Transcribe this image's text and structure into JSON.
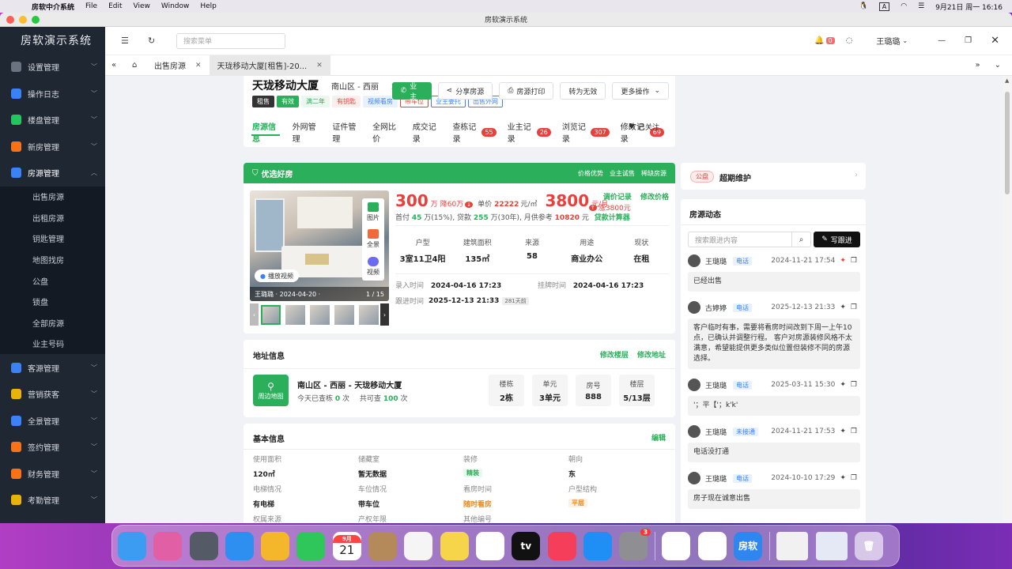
{
  "menubar": {
    "app_name": "房软中介系统",
    "menus": [
      "File",
      "Edit",
      "View",
      "Window",
      "Help"
    ],
    "datetime": "9月21日 周一  16:16",
    "input_indicator": "A"
  },
  "window": {
    "title": "房软演示系统"
  },
  "sidebar": {
    "brand": "房软演示系统",
    "items_top": [
      {
        "label": "设置管理",
        "color": "#6b7280",
        "icon": "gear-icon"
      },
      {
        "label": "操作日志",
        "color": "#3b82f6",
        "icon": "clock-icon"
      },
      {
        "label": "楼盘管理",
        "color": "#22c55e",
        "icon": "chart-icon"
      },
      {
        "label": "新房管理",
        "color": "#f97316",
        "icon": "building-icon"
      },
      {
        "label": "房源管理",
        "color": "#3b82f6",
        "icon": "home-icon"
      }
    ],
    "sub_items": [
      "出售房源",
      "出租房源",
      "钥匙管理",
      "地图找房",
      "公盘",
      "锁盘",
      "全部房源",
      "业主号码"
    ],
    "items_bottom": [
      {
        "label": "客源管理",
        "color": "#3b82f6",
        "icon": "user-icon"
      },
      {
        "label": "营销获客",
        "color": "#eab308",
        "icon": "megaphone-icon"
      },
      {
        "label": "全景管理",
        "color": "#3b82f6",
        "icon": "panorama-icon"
      },
      {
        "label": "签约管理",
        "color": "#f97316",
        "icon": "stamp-icon"
      },
      {
        "label": "财务管理",
        "color": "#f97316",
        "icon": "money-icon"
      },
      {
        "label": "考勤管理",
        "color": "#eab308",
        "icon": "calendar-icon"
      }
    ]
  },
  "topbar": {
    "search_placeholder": "搜索菜单",
    "notify_count": "0",
    "user": "王璐璐"
  },
  "tabs": [
    {
      "label": "出售房源"
    },
    {
      "label": "天珑移动大厦[租售]-20..."
    }
  ],
  "house": {
    "name": "天珑移动大厦",
    "district": "南山区 - 西丽",
    "code": "20786",
    "tags": [
      {
        "text": "租售",
        "bg": "#333333",
        "fg": "#ffffff",
        "bd": "#333333"
      },
      {
        "text": "有效",
        "bg": "#2baf5a",
        "fg": "#ffffff",
        "bd": "#2baf5a"
      },
      {
        "text": "满二年",
        "bg": "#eaf8ef",
        "fg": "#2baf5a",
        "bd": "#eaf8ef"
      },
      {
        "text": "有钥匙",
        "bg": "#fdeeee",
        "fg": "#e8413c",
        "bd": "#fdeeee"
      },
      {
        "text": "视频看房",
        "bg": "#e8f1ff",
        "fg": "#3b82f6",
        "bd": "#e8f1ff"
      },
      {
        "text": "带车位",
        "bg": "#ffffff",
        "fg": "#e8413c",
        "bd": "#e8413c"
      },
      {
        "text": "业主委托",
        "bg": "#ffffff",
        "fg": "#3b82f6",
        "bd": "#3b82f6"
      },
      {
        "text": "出售外网",
        "bg": "#ffffff",
        "fg": "#3b82f6",
        "bd": "#3b82f6"
      }
    ],
    "buttons": {
      "owner": "业主",
      "share": "分享房源",
      "print": "房源打印",
      "invalid": "转为无效",
      "more": "更多操作"
    },
    "subtabs": [
      {
        "label": "房源信息",
        "count": ""
      },
      {
        "label": "外网管理",
        "count": ""
      },
      {
        "label": "证件管理",
        "count": ""
      },
      {
        "label": "全网比价",
        "count": ""
      },
      {
        "label": "成交记录",
        "count": ""
      },
      {
        "label": "查栋记录",
        "count": "55"
      },
      {
        "label": "业主记录",
        "count": "26"
      },
      {
        "label": "浏览记录",
        "count": "307"
      },
      {
        "label": "修改记录",
        "count": "69"
      }
    ],
    "followed": "已关注"
  },
  "premium": {
    "title": "优选好房",
    "links": [
      "价格优势",
      "业主诚售",
      "稀缺房源"
    ]
  },
  "gallery": {
    "side_buttons": [
      "图片",
      "全景",
      "视频"
    ],
    "play_label": "播放视频",
    "caption": "王璐璐 · 2024-04-20 ·",
    "counter": "1 / 15",
    "thumb_count": 5
  },
  "price": {
    "sale": "300",
    "sale_unit": "万",
    "sale_drop": "降60万",
    "unit_price_label": "单价",
    "unit_price": "22222",
    "unit_price_unit": "元/㎡",
    "rent": "3800",
    "rent_unit": "元/月",
    "rent_rise": "涨3800元",
    "links": {
      "adjust": "调价记录",
      "modify": "修改价格"
    },
    "mortgage": {
      "prefix": "首付",
      "down": "45",
      "mid": "万(15%), 贷款",
      "loan": "255",
      "years": "万(30年), 月供参考",
      "monthly": "10820",
      "unit": "元",
      "calc": "贷款计算器"
    }
  },
  "specs": [
    {
      "label": "户型",
      "value": "3室11卫4阳"
    },
    {
      "label": "建筑面积",
      "value": "135㎡"
    },
    {
      "label": "来源",
      "value": "58"
    },
    {
      "label": "用途",
      "value": "商业办公"
    },
    {
      "label": "现状",
      "value": "在租"
    }
  ],
  "dates": {
    "entry_label": "录入时间",
    "entry": "2024-04-16 17:23",
    "listed_label": "挂牌时间",
    "listed": "2024-04-16 17:23",
    "follow_label": "跟进时间",
    "follow": "2025-12-13 21:33",
    "ago": "281天前"
  },
  "address": {
    "title": "地址信息",
    "links": {
      "building": "修改楼层",
      "address": "修改地址"
    },
    "map_label": "周边地图",
    "name": "南山区 - 西丽 - 天珑移动大厦",
    "today_label": "今天已查栋",
    "today": "0",
    "times": "次",
    "total_label": "共可查",
    "total": "100",
    "cells": [
      {
        "label": "楼栋",
        "value": "2栋"
      },
      {
        "label": "单元",
        "value": "3单元"
      },
      {
        "label": "房号",
        "value": "888"
      },
      {
        "label": "楼层",
        "value": "5/13层"
      }
    ]
  },
  "basic": {
    "title": "基本信息",
    "edit": "编辑",
    "fields": [
      {
        "label": "使用面积",
        "value": "120㎡",
        "style": "plain"
      },
      {
        "label": "储藏室",
        "value": "暂无数据",
        "style": "plain"
      },
      {
        "label": "装修",
        "value": "精装",
        "style": "green"
      },
      {
        "label": "朝向",
        "value": "东",
        "style": "plain"
      },
      {
        "label": "电梯情况",
        "value": "有电梯",
        "style": "plain"
      },
      {
        "label": "车位情况",
        "value": "带车位",
        "style": "plain"
      },
      {
        "label": "看房时间",
        "value": "随时看房",
        "style": "orange"
      },
      {
        "label": "户型结构",
        "value": "平层",
        "style": "orangebadge"
      },
      {
        "label": "权属来源",
        "value": "一手",
        "style": "plain"
      },
      {
        "label": "产权年限",
        "value": "70年",
        "style": "plain"
      },
      {
        "label": "其他编号",
        "value": "147",
        "style": "plain"
      }
    ]
  },
  "right": {
    "pan_tag": "公盘",
    "pan_status": "超期维护",
    "feed_title": "房源动态",
    "search_placeholder": "搜索跟进内容",
    "write_btn": "写跟进",
    "entries": [
      {
        "name": "王璐璐",
        "type": "电话",
        "time": "2024-11-21 17:54",
        "pinned": true,
        "msg": "已经出售"
      },
      {
        "name": "古婷婷",
        "type": "电话",
        "time": "2025-12-13 21:33",
        "pinned": false,
        "msg": "客户临时有事，需要将看房时间改到下周一上午10点，已确认并调整行程。 客户对房源装修风格不太满意，希望能提供更多类似位置但装修不同的房源选择。"
      },
      {
        "name": "王璐璐",
        "type": "电话",
        "time": "2025-03-11 15:30",
        "pinned": false,
        "msg": "'；平【'；k'k'"
      },
      {
        "name": "王璐璐",
        "type": "未接通",
        "time": "2024-11-21 17:53",
        "pinned": false,
        "msg": "电话没打通"
      },
      {
        "name": "王璐璐",
        "type": "电话",
        "time": "2024-10-10 17:29",
        "pinned": false,
        "msg": "房子现在诚意出售"
      }
    ]
  },
  "dock": {
    "apps": [
      {
        "name": "finder",
        "color": "#3b9cf2",
        "label": ""
      },
      {
        "name": "launchpad",
        "color": "#e05fa5",
        "label": ""
      },
      {
        "name": "screenshot",
        "color": "#555b66",
        "label": ""
      },
      {
        "name": "safari",
        "color": "#2f8ff0",
        "label": ""
      },
      {
        "name": "photos",
        "color": "#f4b62a",
        "label": ""
      },
      {
        "name": "facetime",
        "color": "#2fc65a",
        "label": ""
      },
      {
        "name": "calendar",
        "color": "#ffffff",
        "label": "21"
      },
      {
        "name": "contacts",
        "color": "#b58a5a",
        "label": ""
      },
      {
        "name": "reminders",
        "color": "#f5f5f5",
        "label": ""
      },
      {
        "name": "notes",
        "color": "#f7d54a",
        "label": ""
      },
      {
        "name": "freeform",
        "color": "#ffffff",
        "label": ""
      },
      {
        "name": "tv",
        "color": "#111111",
        "label": "tv"
      },
      {
        "name": "music",
        "color": "#f43e5a",
        "label": ""
      },
      {
        "name": "appstore",
        "color": "#1f8ef5",
        "label": ""
      },
      {
        "name": "settings",
        "color": "#8e8e93",
        "label": ""
      },
      {
        "name": "qq",
        "color": "#ffffff",
        "label": ""
      },
      {
        "name": "chrome",
        "color": "#ffffff",
        "label": ""
      },
      {
        "name": "fangruan",
        "color": "#2f86ee",
        "label": "房软"
      }
    ],
    "calendar_month": "9月",
    "settings_badge": "3"
  }
}
